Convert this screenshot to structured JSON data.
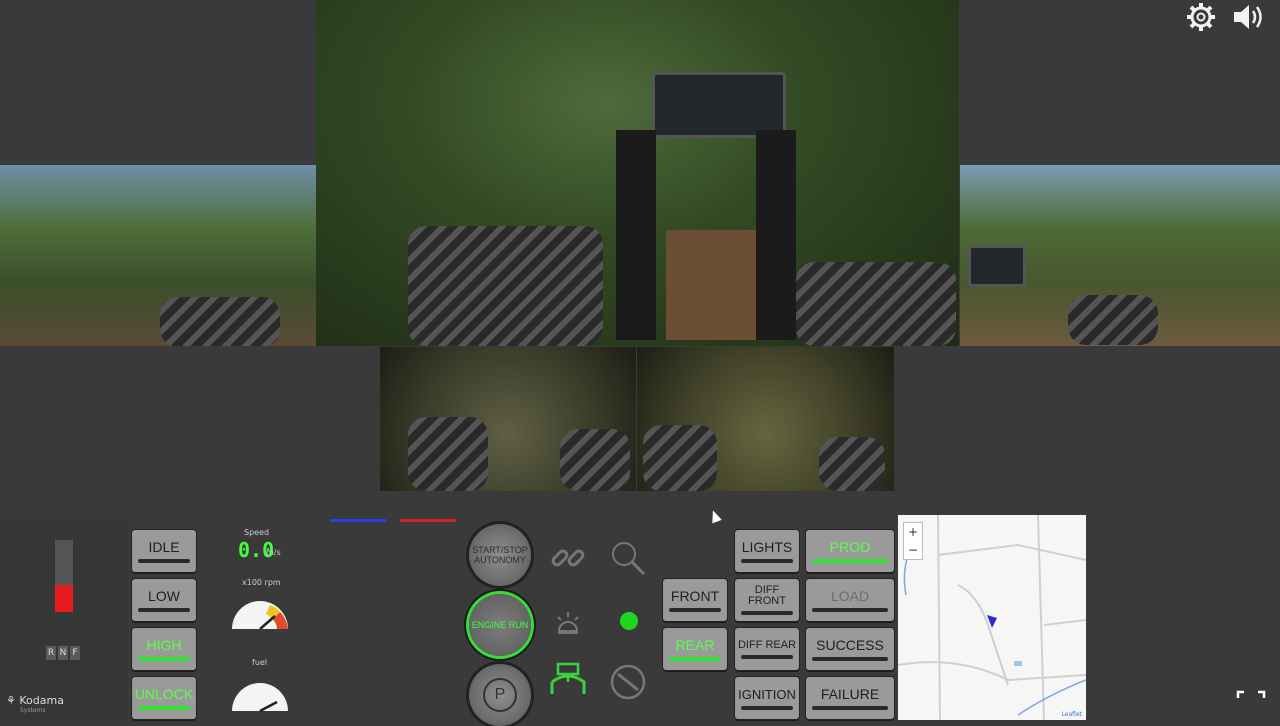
{
  "brand": {
    "name": "Kodama",
    "sub": "Systems"
  },
  "top_icons": {
    "settings": "gear-icon",
    "sound": "speaker-icon"
  },
  "throttle": {
    "level_fraction": 0.38,
    "color": "#e61b1b"
  },
  "gears": [
    "R",
    "N",
    "F"
  ],
  "speed": {
    "label": "Speed",
    "value": "0.0",
    "unit": "m/s"
  },
  "rpm": {
    "label": "x100 rpm"
  },
  "fuel": {
    "label": "fuel"
  },
  "left_buttons": [
    {
      "label": "IDLE",
      "active": false
    },
    {
      "label": "LOW",
      "active": false
    },
    {
      "label": "HIGH",
      "active": true
    },
    {
      "label": "UNLOCK",
      "active": true
    }
  ],
  "round_buttons": {
    "autonomy": "START/STOP AUTONOMY",
    "engine": "ENGINE RUN",
    "parking": "P"
  },
  "mid_buttons": [
    {
      "label": "FRONT",
      "active": false
    },
    {
      "label": "REAR",
      "active": true
    }
  ],
  "right_buttons": [
    {
      "label": "LIGHTS",
      "active": false
    },
    {
      "label": "PROD",
      "active": true
    },
    {
      "label": "DIFF FRONT",
      "active": false
    },
    {
      "label": "LOAD",
      "active": false
    },
    {
      "label": "DIFF REAR",
      "active": false
    },
    {
      "label": "SUCCESS",
      "active": false
    },
    {
      "label": "IGNITION",
      "active": false
    },
    {
      "label": "FAILURE",
      "active": false
    }
  ],
  "map": {
    "zoom_in": "+",
    "zoom_out": "−",
    "attribution": "Leaflet"
  },
  "colors": {
    "active_green": "#5cff4a",
    "indicator_blue": "#2f3fe0",
    "indicator_red": "#d0262b"
  }
}
